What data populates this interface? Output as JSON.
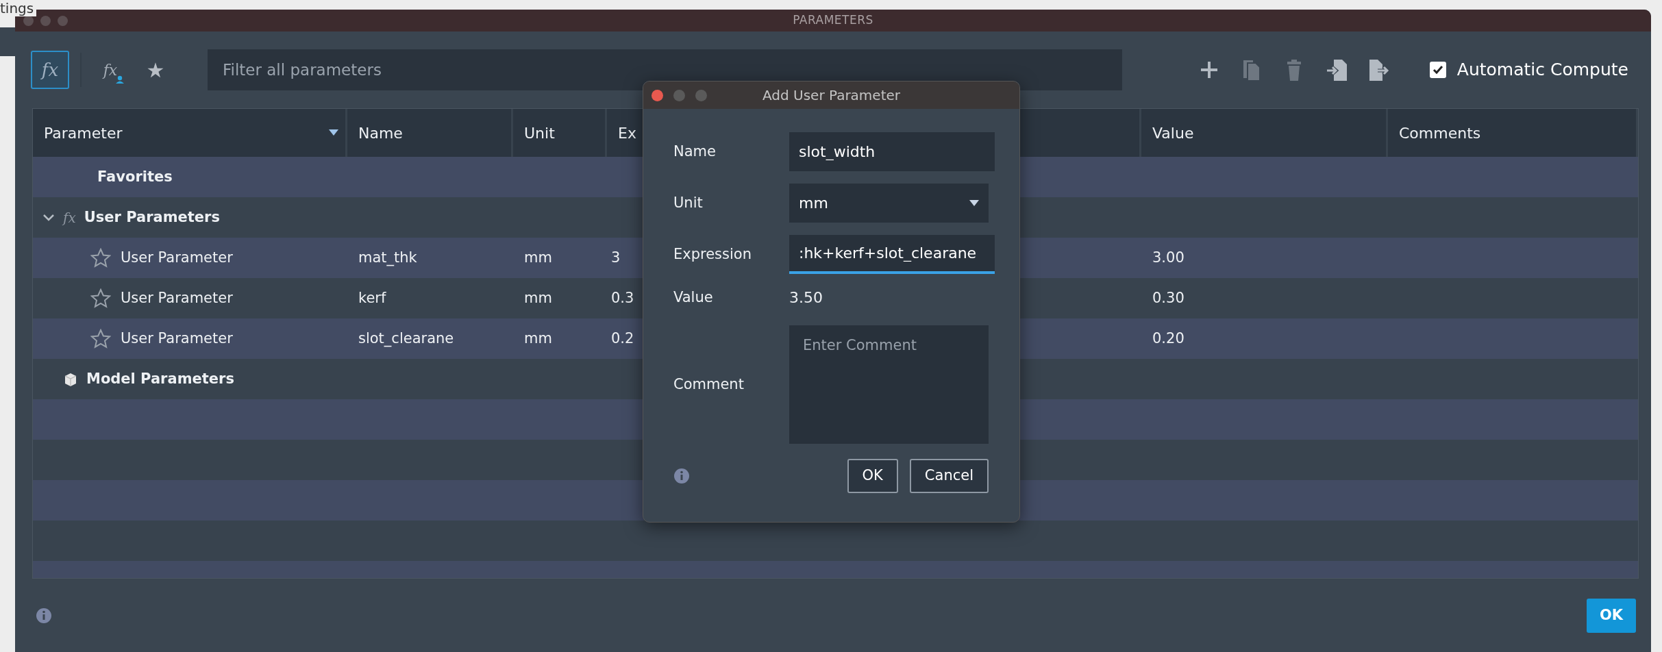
{
  "background_window": {
    "text": "tings"
  },
  "window": {
    "title": "PARAMETERS"
  },
  "toolbar": {
    "filters": [
      {
        "kind": "all",
        "glyph": "fx",
        "selected": true
      },
      {
        "kind": "user",
        "glyph": "fx",
        "selected": false
      },
      {
        "kind": "favorites",
        "glyph": "★",
        "selected": false
      }
    ],
    "search": {
      "placeholder": "Filter all parameters"
    },
    "actions": [
      {
        "kind": "add",
        "disabled": false
      },
      {
        "kind": "copy",
        "disabled": true
      },
      {
        "kind": "delete",
        "disabled": true
      },
      {
        "kind": "import",
        "disabled": false
      },
      {
        "kind": "export",
        "disabled": false
      }
    ],
    "automatic_compute": {
      "label": "Automatic Compute",
      "checked": true
    }
  },
  "table": {
    "columns": [
      {
        "label": "Parameter",
        "sort": true
      },
      {
        "label": "Name",
        "sort": false
      },
      {
        "label": "Unit",
        "sort": false
      },
      {
        "label": "Ex",
        "sort": false
      },
      {
        "label": "Value",
        "sort": false
      },
      {
        "label": "Comments",
        "sort": false
      }
    ],
    "groups": [
      {
        "kind": "favorites",
        "label": "Favorites",
        "expanded": false
      },
      {
        "kind": "user",
        "label": "User Parameters",
        "glyph": "fx",
        "expanded": true,
        "children": [
          {
            "parameter": "User Parameter",
            "name": "mat_thk",
            "unit": "mm",
            "expression": "3",
            "value": "3.00",
            "favorite": false
          },
          {
            "parameter": "User Parameter",
            "name": "kerf",
            "unit": "mm",
            "expression": "0.3",
            "value": "0.30",
            "favorite": false
          },
          {
            "parameter": "User Parameter",
            "name": "slot_clearane",
            "unit": "mm",
            "expression": "0.2",
            "value": "0.20",
            "favorite": false
          }
        ]
      },
      {
        "kind": "model",
        "label": "Model Parameters",
        "expanded": false
      }
    ]
  },
  "footer": {
    "ok": "OK"
  },
  "dialog": {
    "title": "Add User Parameter",
    "fields": [
      {
        "kind": "text",
        "label": "Name",
        "value": "slot_width",
        "focused": false
      },
      {
        "kind": "select",
        "label": "Unit",
        "value": "mm",
        "focused": false
      },
      {
        "kind": "text",
        "label": "Expression",
        "value": ":hk+kerf+slot_clearane",
        "focused": true
      },
      {
        "kind": "readout",
        "label": "Value",
        "value": "3.50"
      },
      {
        "kind": "textarea",
        "label": "Comment",
        "placeholder": "Enter Comment"
      }
    ],
    "buttons": [
      "OK",
      "Cancel"
    ]
  }
}
